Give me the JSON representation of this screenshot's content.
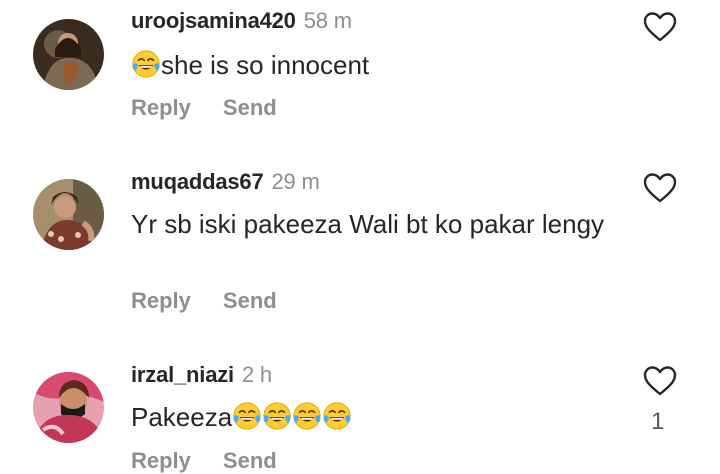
{
  "comments": [
    {
      "username": "uroojsamina420",
      "time": "58 m",
      "text": "she is so innocent",
      "emoji_prefix": [
        "face-with-tears-of-joy"
      ],
      "emoji_suffix": [],
      "like_count": "",
      "reply_label": "Reply",
      "send_label": "Send"
    },
    {
      "username": "muqaddas67",
      "time": "29 m",
      "text": "Yr sb iski pakeeza Wali bt ko pakar lengy",
      "emoji_prefix": [],
      "emoji_suffix": [],
      "like_count": "",
      "reply_label": "Reply",
      "send_label": "Send"
    },
    {
      "username": "irzal_niazi",
      "time": "2 h",
      "text": "Pakeeza",
      "emoji_prefix": [],
      "emoji_suffix": [
        "face-with-tears-of-joy",
        "face-with-tears-of-joy",
        "face-with-tears-of-joy",
        "face-with-tears-of-joy"
      ],
      "like_count": "1",
      "reply_label": "Reply",
      "send_label": "Send"
    }
  ],
  "icons": {
    "like": "heart-outline-icon",
    "emoji": "face-with-tears-of-joy"
  },
  "colors": {
    "text": "#262626",
    "muted": "#8e8e8e",
    "emoji": "#ffcc33"
  }
}
